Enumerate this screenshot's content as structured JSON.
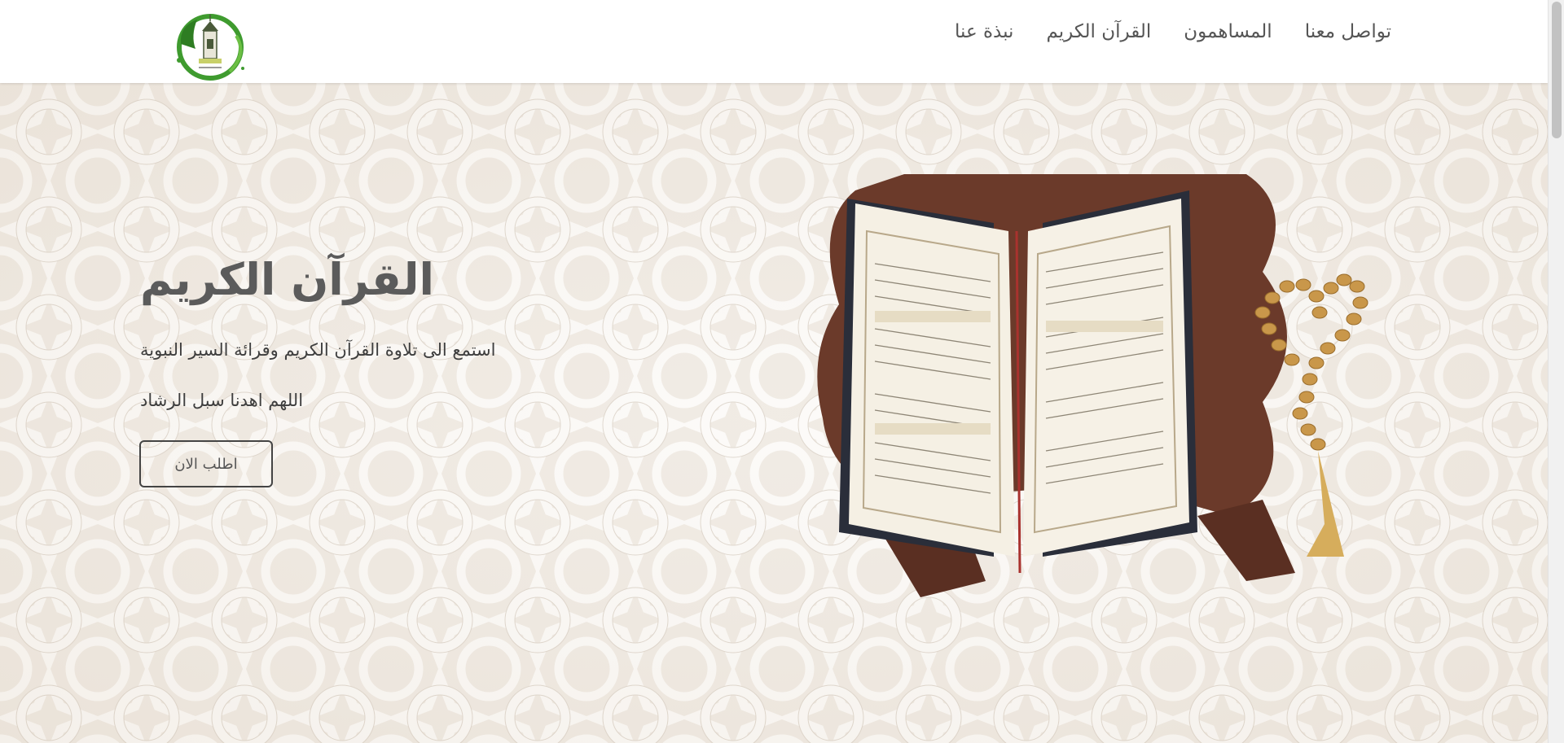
{
  "nav": {
    "items": [
      {
        "label": "نبذة عنا"
      },
      {
        "label": "القرآن الكريم"
      },
      {
        "label": "المساهمون"
      },
      {
        "label": "تواصل معنا"
      }
    ]
  },
  "hero": {
    "title": "القرآن الكريم",
    "subtitle": "استمع الى تلاوة القرآن الكريم وقرائة السير النبوية",
    "dua": "اللهم اهدنا سبل الرشاد",
    "cta_label": "اطلب الان"
  },
  "colors": {
    "background": "#f1ece6",
    "pattern_lines": "#ffffff",
    "logo_green": "#3f9b2f",
    "book_stand": "#6b3a2a",
    "prayer_beads": "#c9974a"
  },
  "icons": {
    "logo": "minaret-logo-icon",
    "book": "quran-book-image",
    "beads": "prayer-beads-image"
  }
}
